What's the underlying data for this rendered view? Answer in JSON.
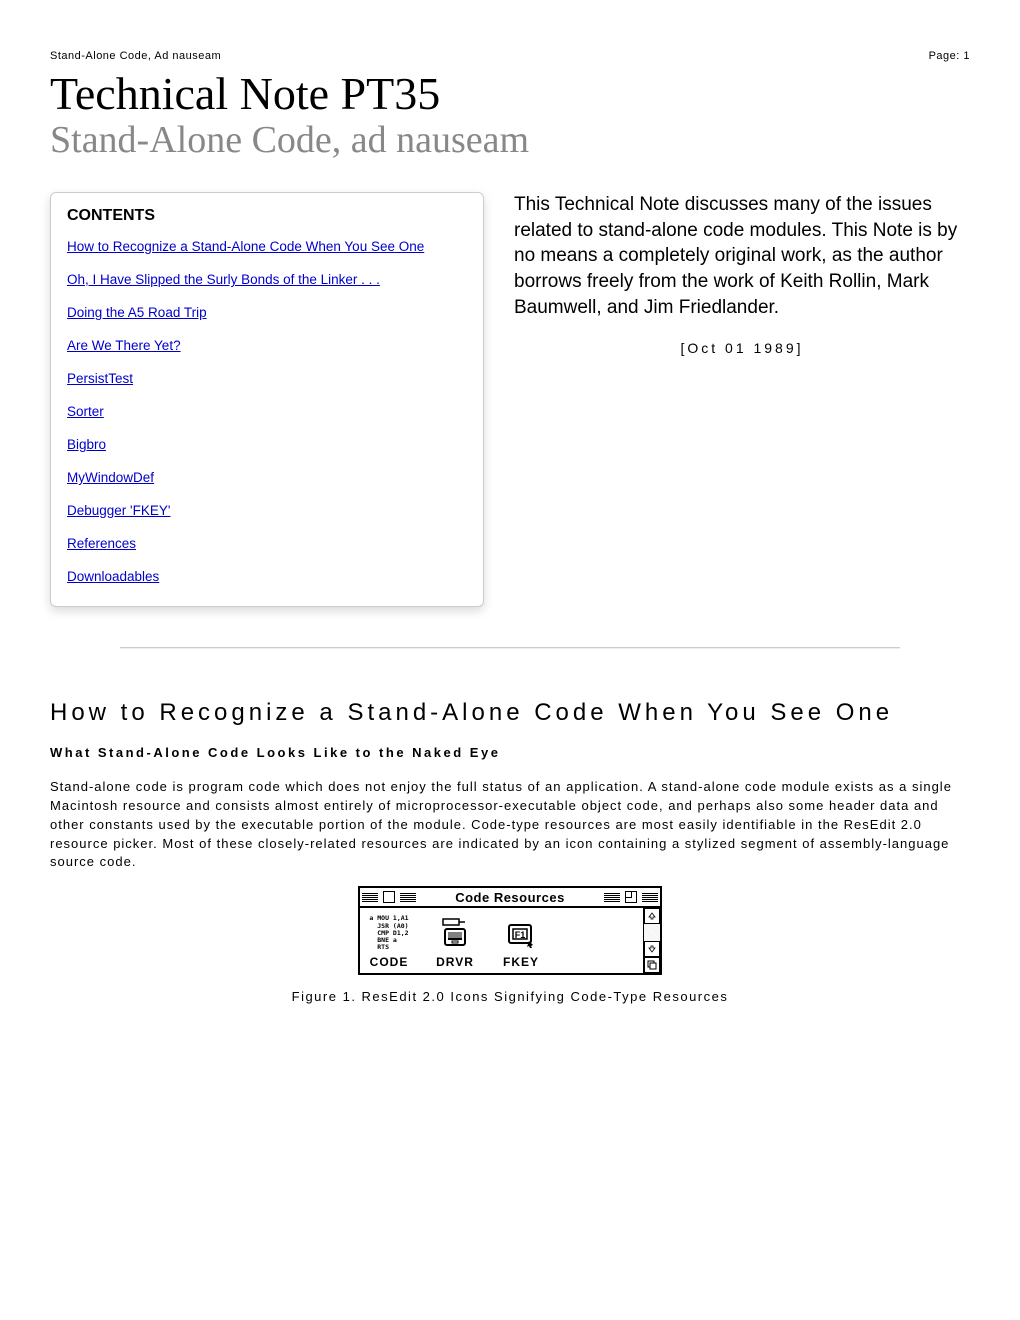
{
  "header": {
    "left": "Stand-Alone Code, Ad nauseam",
    "right": "Page: 1"
  },
  "title": {
    "main": "Technical Note PT35",
    "sub": "Stand-Alone Code, ad nauseam"
  },
  "toc": {
    "heading": "CONTENTS",
    "items": [
      "How to Recognize a Stand-Alone Code When You See One",
      "Oh, I Have Slipped the Surly Bonds of the Linker . . .",
      "Doing the A5 Road Trip",
      "Are We There Yet?",
      "PersistTest",
      "Sorter",
      "Bigbro",
      "MyWindowDef",
      "Debugger 'FKEY'",
      "References",
      "Downloadables"
    ]
  },
  "intro": {
    "text": "This Technical Note discusses many of the issues related to stand-alone code modules. This Note is by no means a completely original work, as the author borrows freely from the work of Keith Rollin, Mark Baumwell, and Jim Friedlander.",
    "date": "[Oct 01 1989]"
  },
  "section": {
    "heading": "How to Recognize a Stand-Alone Code When You See One",
    "subheading": "What Stand-Alone Code Looks Like to the Naked Eye",
    "body": "Stand-alone code is program code which does not enjoy the full status of an application. A stand-alone code module exists as a single Macintosh resource and consists almost entirely of microprocessor-executable object code, and perhaps also some header data and other constants used by the executable portion of the module. Code-type resources are most easily identifiable in the ResEdit 2.0 resource picker. Most of these closely-related resources are indicated by an icon containing a stylized segment of assembly-language source code."
  },
  "figure": {
    "window_title": "Code Resources",
    "items": [
      {
        "icon_text": "a MOU 1,A1\n  JSR (A0)\n  CMP D1,2\n  BNE a\n  RTS",
        "label": "CODE"
      },
      {
        "label": "DRVR"
      },
      {
        "label": "FKEY"
      }
    ],
    "caption": "Figure 1. ResEdit 2.0 Icons Signifying Code-Type Resources"
  }
}
